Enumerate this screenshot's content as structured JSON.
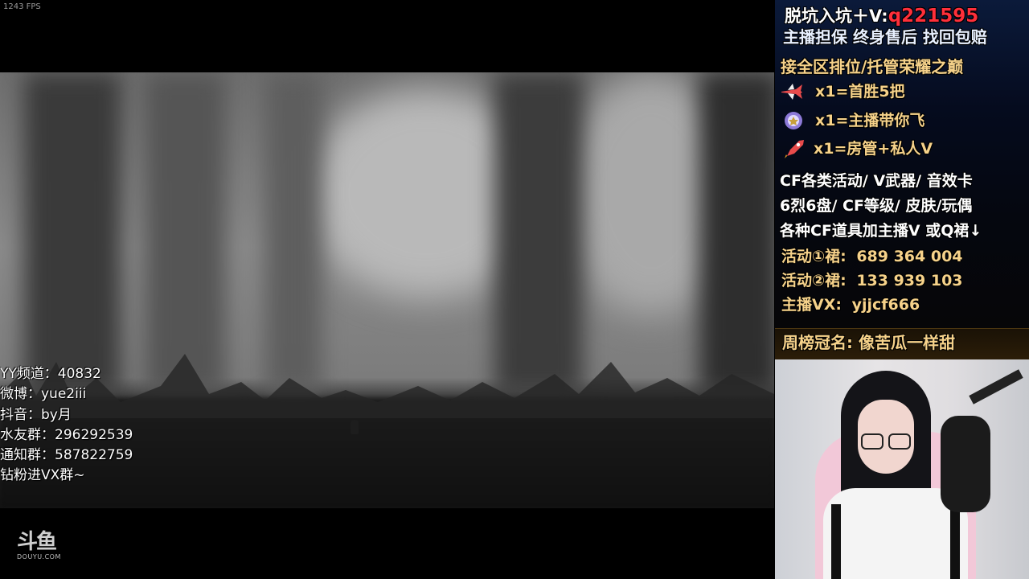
{
  "overlay": {
    "fps": "1243 FPS"
  },
  "socials": [
    "YY频道：40832",
    "微博：yue2iii",
    "抖音：by月",
    "水友群：296292539",
    "通知群：587822759",
    "钻粉进VX群~"
  ],
  "platform_logo": {
    "main": "斗鱼",
    "sub": "DOUYU.COM"
  },
  "sidebar_ad": {
    "line1_prefix": "脱坑入坑＋V:",
    "line1_id": "q221595",
    "line2": "主播担保 终身售后 找回包赔",
    "line3": "接全区排位/托管荣耀之巅",
    "gifts": [
      {
        "icon": "airplane-icon",
        "text": "x1=首胜5把"
      },
      {
        "icon": "badge-icon",
        "text": "x1=主播带你飞"
      },
      {
        "icon": "rocket-icon",
        "text": "x1=房管+私人V"
      }
    ],
    "cf_lines": [
      "CF各类活动/ V武器/ 音效卡",
      "6烈6盘/ CF等级/ 皮肤/玩偶",
      "各种CF道具加主播V 或Q裙↓"
    ],
    "contacts": [
      {
        "label": "活动①裙:",
        "value": "689 364 004"
      },
      {
        "label": "活动②裙:",
        "value": "133 939 103"
      },
      {
        "label": "主播VX:",
        "value": "yjjcf666"
      }
    ],
    "weekly_champion": "周榜冠名: 像苦瓜一样甜"
  },
  "colors": {
    "gold": "#f6d28a",
    "red": "#ff2f3a"
  }
}
